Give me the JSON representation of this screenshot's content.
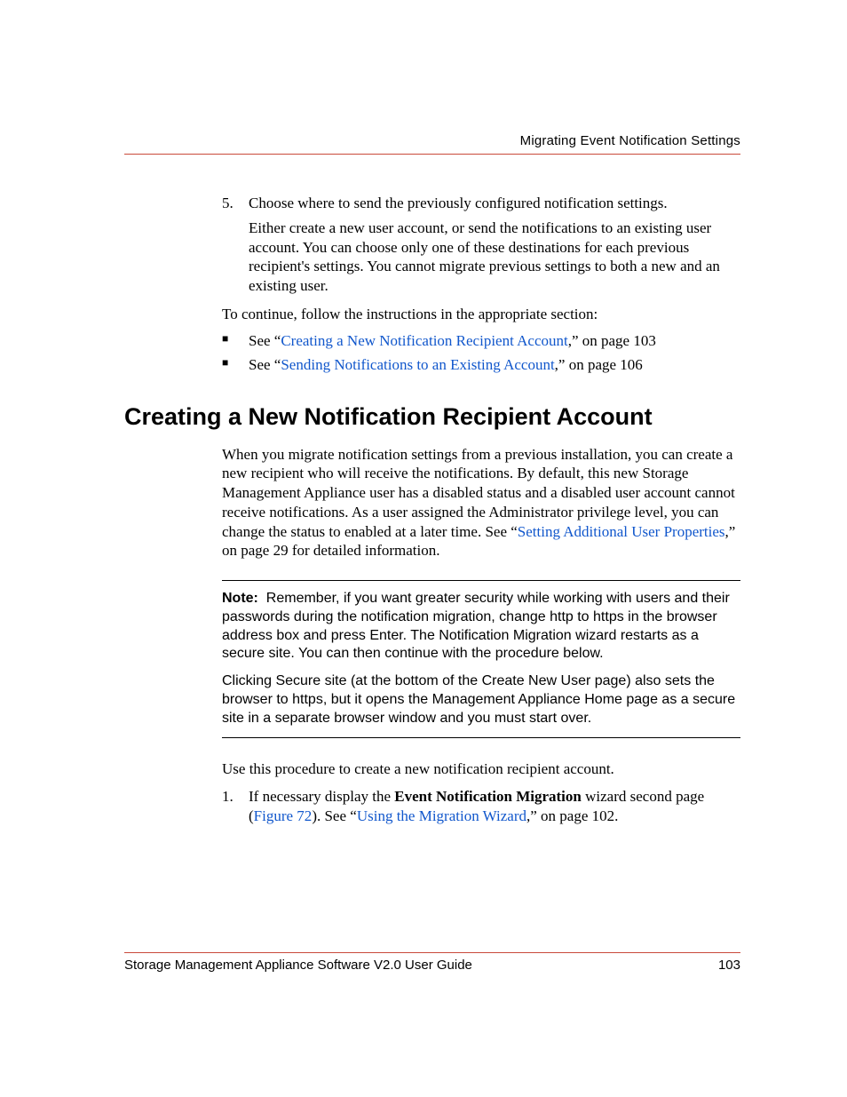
{
  "header": {
    "section_title": "Migrating Event Notification Settings"
  },
  "step5": {
    "number": "5.",
    "lead": "Choose where to send the previously configured notification settings.",
    "detail": "Either create a new user account, or send the notifications to an existing user account. You can choose only one of these destinations for each previous recipient's settings. You cannot migrate previous settings to both a new and an existing user."
  },
  "continue_text": "To continue, follow the instructions in the appropriate section:",
  "bullets": [
    {
      "prefix": "See “",
      "link": "Creating a New Notification Recipient Account",
      "suffix": ",” on page 103"
    },
    {
      "prefix": "See “",
      "link": "Sending Notifications to an Existing Account",
      "suffix": ",” on page 106"
    }
  ],
  "section": {
    "heading": "Creating a New Notification Recipient Account",
    "para_pre": "When you migrate notification settings from a previous installation, you can create a new recipient who will receive the notifications. By default, this new Storage Management Appliance user has a disabled status and a disabled user account cannot receive notifications. As a user assigned the Administrator privilege level, you can change the status to enabled at a later time. See “",
    "para_link": "Setting Additional User Properties",
    "para_post": ",” on page 29 for detailed information."
  },
  "note": {
    "label": "Note:",
    "body1": "Remember, if you want greater security while working with users and their passwords during the notification migration, change http to https in the browser address box and press Enter. The Notification Migration wizard restarts as a secure site. You can then continue with the procedure below.",
    "body2": "Clicking Secure site (at the bottom of the Create New User page) also sets the browser to https, but it opens the Management Appliance Home page as a secure site in a separate browser window and you must start over."
  },
  "after_note": "Use this procedure to create a new notification recipient account.",
  "step1": {
    "number": "1.",
    "pre": "If necessary display the ",
    "bold": "Event Notification Migration",
    "mid1": " wizard second page (",
    "link1": "Figure 72",
    "mid2": "). See “",
    "link2": "Using the Migration Wizard",
    "post": ",” on page 102."
  },
  "footer": {
    "doc_title": "Storage Management Appliance Software V2.0 User Guide",
    "page_number": "103"
  }
}
